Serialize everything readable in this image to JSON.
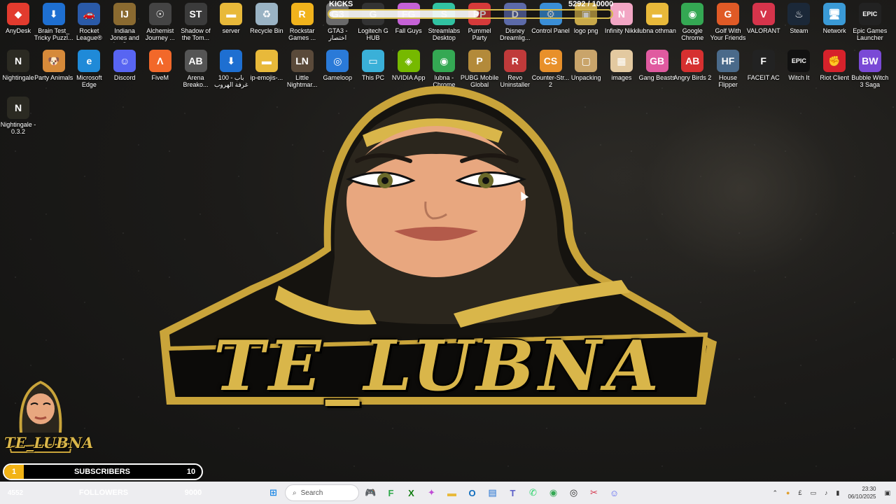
{
  "desktop_icons": [
    {
      "id": "anydesk",
      "label": "AnyDesk",
      "col": 0,
      "row": 0,
      "color": "#e23b2e",
      "glyph": "◆"
    },
    {
      "id": "brain-test",
      "label": "Brain Test_ Tricky Puzzl...",
      "col": 1,
      "row": 0,
      "color": "#1e6fd1",
      "glyph": "⬇"
    },
    {
      "id": "rocket-league",
      "label": "Rocket League®",
      "col": 2,
      "row": 0,
      "color": "#2a5aa8",
      "glyph": "🚗"
    },
    {
      "id": "indiana-jones",
      "label": "Indiana Jones and the Gre...",
      "col": 3,
      "row": 0,
      "color": "#8a6a30",
      "glyph": "IJ"
    },
    {
      "id": "alchemist",
      "label": "Alchemist Journey ...",
      "col": 4,
      "row": 0,
      "color": "#444",
      "glyph": "☉"
    },
    {
      "id": "shadow-tomb",
      "label": "Shadow of the Tom...",
      "col": 5,
      "row": 0,
      "color": "#3b3b3b",
      "glyph": "ST"
    },
    {
      "id": "server",
      "label": "server",
      "col": 6,
      "row": 0,
      "color": "#e8b93a",
      "glyph": "▬"
    },
    {
      "id": "recycle-bin",
      "label": "Recycle Bin",
      "col": 7,
      "row": 0,
      "color": "#9ab3c4",
      "glyph": "♻"
    },
    {
      "id": "rockstar",
      "label": "Rockstar Games ...",
      "col": 8,
      "row": 0,
      "color": "#f1b31c",
      "glyph": "R"
    },
    {
      "id": "gta3",
      "label": "GTA3 - اختصار",
      "col": 9,
      "row": 0,
      "color": "#6a6a6a",
      "glyph": "G3"
    },
    {
      "id": "logitech",
      "label": "Logitech G HUB",
      "col": 10,
      "row": 0,
      "color": "#333",
      "glyph": "G"
    },
    {
      "id": "fall-guys",
      "label": "Fall Guys",
      "col": 11,
      "row": 0,
      "color": "#c562d6",
      "glyph": "FG"
    },
    {
      "id": "streamlabs",
      "label": "Streamlabs Desktop",
      "col": 12,
      "row": 0,
      "color": "#31c3a2",
      "glyph": "S"
    },
    {
      "id": "pummel-party",
      "label": "Pummel Party",
      "col": 13,
      "row": 0,
      "color": "#d63a3a",
      "glyph": "PP"
    },
    {
      "id": "disney",
      "label": "Disney Dreamlig...",
      "col": 14,
      "row": 0,
      "color": "#5c6aa8",
      "glyph": "D"
    },
    {
      "id": "control-panel",
      "label": "Control Panel",
      "col": 15,
      "row": 0,
      "color": "#3a8ed6",
      "glyph": "⚙"
    },
    {
      "id": "logo-png",
      "label": "logo png",
      "col": 16,
      "row": 0,
      "color": "#c9a94a",
      "glyph": "▣"
    },
    {
      "id": "infinity-nikki",
      "label": "Infinity Nikki",
      "col": 17,
      "row": 0,
      "color": "#f2a6c4",
      "glyph": "N"
    },
    {
      "id": "lubna-othman",
      "label": "lubna othman",
      "col": 18,
      "row": 0,
      "color": "#e8b93a",
      "glyph": "▬"
    },
    {
      "id": "chrome",
      "label": "Google Chrome",
      "col": 19,
      "row": 0,
      "color": "#34a853",
      "glyph": "◉"
    },
    {
      "id": "golf",
      "label": "Golf With Your Friends",
      "col": 20,
      "row": 0,
      "color": "#e05a26",
      "glyph": "G"
    },
    {
      "id": "valorant",
      "label": "VALORANT",
      "col": 21,
      "row": 0,
      "color": "#d6344b",
      "glyph": "V"
    },
    {
      "id": "steam",
      "label": "Steam",
      "col": 22,
      "row": 0,
      "color": "#1b2838",
      "glyph": "♨"
    },
    {
      "id": "network",
      "label": "Network",
      "col": 23,
      "row": 0,
      "color": "#3a9ad6",
      "glyph": "🖥"
    },
    {
      "id": "epic-launcher",
      "label": "Epic Games Launcher",
      "col": 24,
      "row": 0,
      "color": "#222",
      "glyph": "EPIC"
    },
    {
      "id": "nightingale",
      "label": "Nightingale",
      "col": 0,
      "row": 1,
      "color": "#2b2a22",
      "glyph": "N"
    },
    {
      "id": "party-animals",
      "label": "Party Animals",
      "col": 1,
      "row": 1,
      "color": "#d68a3a",
      "glyph": "🐶"
    },
    {
      "id": "edge",
      "label": "Microsoft Edge",
      "col": 2,
      "row": 1,
      "color": "#1f8ad8",
      "glyph": "e"
    },
    {
      "id": "discord",
      "label": "Discord",
      "col": 3,
      "row": 1,
      "color": "#5865f2",
      "glyph": "☺"
    },
    {
      "id": "fivem",
      "label": "FiveM",
      "col": 4,
      "row": 1,
      "color": "#f2682a",
      "glyph": "Λ"
    },
    {
      "id": "arena",
      "label": "Arena Breako...",
      "col": 5,
      "row": 1,
      "color": "#555",
      "glyph": "AB"
    },
    {
      "id": "100-ways",
      "label": "100 باب - غرفة الهروب ...",
      "col": 6,
      "row": 1,
      "color": "#1e6fd1",
      "glyph": "⬇"
    },
    {
      "id": "ip-emojis",
      "label": "ip-emojis-...",
      "col": 7,
      "row": 1,
      "color": "#e8b93a",
      "glyph": "▬"
    },
    {
      "id": "little-nightmares",
      "label": "Little Nightmar...",
      "col": 8,
      "row": 1,
      "color": "#5a4a3a",
      "glyph": "LN"
    },
    {
      "id": "gameloop",
      "label": "Gameloop",
      "col": 9,
      "row": 1,
      "color": "#2a7ad8",
      "glyph": "◎"
    },
    {
      "id": "this-pc",
      "label": "This PC",
      "col": 10,
      "row": 1,
      "color": "#3ab0d8",
      "glyph": "▭"
    },
    {
      "id": "nvidia",
      "label": "NVIDIA App",
      "col": 11,
      "row": 1,
      "color": "#76b900",
      "glyph": "◈"
    },
    {
      "id": "lubna-chrome",
      "label": "lubna - Chrome",
      "col": 12,
      "row": 1,
      "color": "#34a853",
      "glyph": "◉"
    },
    {
      "id": "pubg",
      "label": "PUBG Mobile Global",
      "col": 13,
      "row": 1,
      "color": "#b38a3a",
      "glyph": "P"
    },
    {
      "id": "revo",
      "label": "Revo Uninstaller",
      "col": 14,
      "row": 1,
      "color": "#c03a3a",
      "glyph": "R"
    },
    {
      "id": "counter-strike",
      "label": "Counter-Str... 2",
      "col": 15,
      "row": 1,
      "color": "#e8902a",
      "glyph": "CS"
    },
    {
      "id": "unpacking",
      "label": "Unpacking",
      "col": 16,
      "row": 1,
      "color": "#c9a46a",
      "glyph": "▢"
    },
    {
      "id": "images",
      "label": "images",
      "col": 17,
      "row": 1,
      "color": "#e3c9a0",
      "glyph": "▦"
    },
    {
      "id": "gang-beasts",
      "label": "Gang Beasts",
      "col": 18,
      "row": 1,
      "color": "#e05aa0",
      "glyph": "GB"
    },
    {
      "id": "angry-birds",
      "label": "Angry Birds 2",
      "col": 19,
      "row": 1,
      "color": "#d63030",
      "glyph": "AB"
    },
    {
      "id": "house-flipper",
      "label": "House Flipper",
      "col": 20,
      "row": 1,
      "color": "#4a6a8a",
      "glyph": "HF"
    },
    {
      "id": "faceit",
      "label": "FACEIT AC",
      "col": 21,
      "row": 1,
      "color": "#222",
      "glyph": "F"
    },
    {
      "id": "witch-it",
      "label": "Witch It",
      "col": 22,
      "row": 1,
      "color": "#111",
      "glyph": "EPIC"
    },
    {
      "id": "riot",
      "label": "Riot Client",
      "col": 23,
      "row": 1,
      "color": "#d6222b",
      "glyph": "✊"
    },
    {
      "id": "bubble-witch",
      "label": "Bubble Witch 3 Saga",
      "col": 24,
      "row": 1,
      "color": "#7a4ad6",
      "glyph": "BW"
    },
    {
      "id": "nightingale-032",
      "label": "Nightingale - 0.3.2",
      "col": 0,
      "row": 2,
      "color": "#2b2a22",
      "glyph": "N"
    }
  ],
  "kicks": {
    "label": "KICKS",
    "count": "5292 / 10000",
    "progress": 0.5292
  },
  "logo": {
    "text": "TE_LUBNA",
    "mini_text": "TE_LUBNA"
  },
  "subscribers": {
    "current": "1",
    "label": "SUBSCRIBERS",
    "goal": "10",
    "progress": 0.1
  },
  "followers": {
    "current": "4552",
    "label": "FOLLOWERS",
    "goal": "9000",
    "progress": 0.5058
  },
  "taskbar": {
    "search_placeholder": "Search",
    "apps": [
      {
        "name": "start-button",
        "glyph": "⊞",
        "color": "#1e88e5"
      },
      {
        "name": "search"
      },
      {
        "name": "widget-app",
        "glyph": "🎮",
        "color": "#3a6ad8"
      },
      {
        "name": "famlog-app",
        "glyph": "F",
        "color": "#2ea84a"
      },
      {
        "name": "xbox-app",
        "glyph": "X",
        "color": "#107c10"
      },
      {
        "name": "copilot-app",
        "glyph": "✦",
        "color": "#c04ad6"
      },
      {
        "name": "file-explorer",
        "glyph": "▬",
        "color": "#e8b93a"
      },
      {
        "name": "outlook-app",
        "glyph": "O",
        "color": "#0f6cbd"
      },
      {
        "name": "store-app",
        "glyph": "▤",
        "color": "#1e6fd1"
      },
      {
        "name": "teams-app",
        "glyph": "T",
        "color": "#5b5fc7"
      },
      {
        "name": "whatsapp-app",
        "glyph": "✆",
        "color": "#25d366"
      },
      {
        "name": "chrome-app",
        "glyph": "◉",
        "color": "#34a853"
      },
      {
        "name": "obs-app",
        "glyph": "◎",
        "color": "#2a2a2a"
      },
      {
        "name": "snip-app",
        "glyph": "✂",
        "color": "#d6344b"
      },
      {
        "name": "discord-app",
        "glyph": "☺",
        "color": "#5865f2"
      }
    ],
    "tray": {
      "time": "23:30",
      "date": "06/10/2025"
    }
  }
}
